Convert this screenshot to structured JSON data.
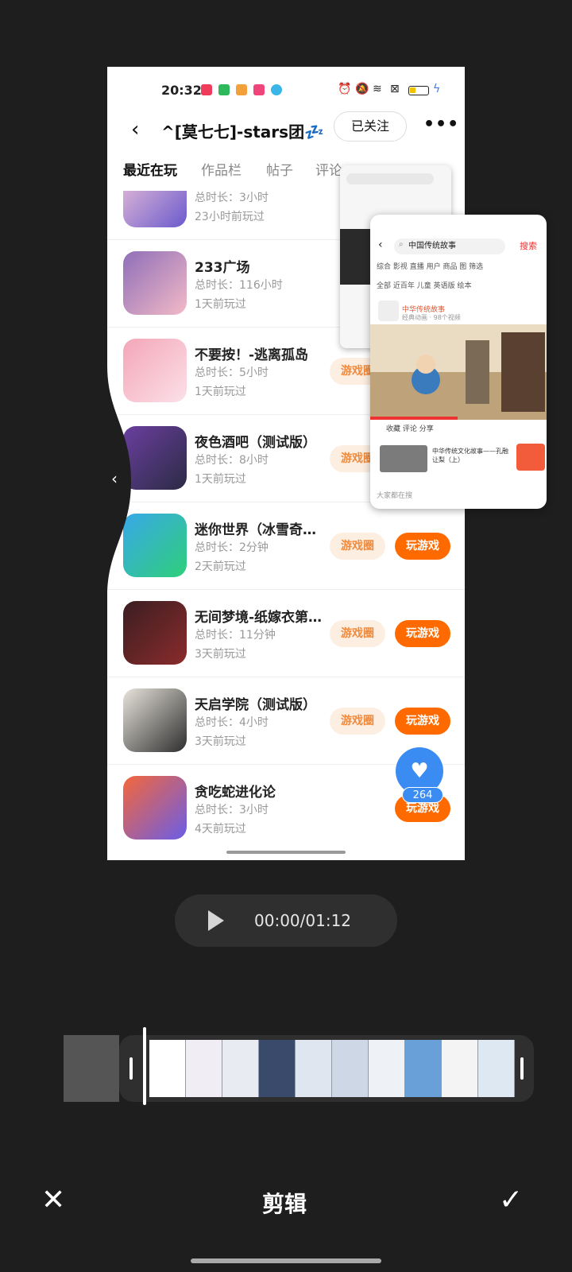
{
  "preview": {
    "status_time": "20:32",
    "title": "^[莫七七]-stars团💤",
    "follow_label": "已关注",
    "more_label": "•••",
    "tabs": [
      "最近在玩",
      "作品栏",
      "帖子",
      "评论"
    ],
    "games": [
      {
        "name": "",
        "duration": "总时长：3小时",
        "last": "23小时前玩过",
        "colors": [
          "#f2c6d8",
          "#6a5acd"
        ]
      },
      {
        "name": "233广场",
        "duration": "总时长：116小时",
        "last": "1天前玩过",
        "colors": [
          "#8e6fb8",
          "#f3b9c7"
        ]
      },
      {
        "name": "不要按！-逃离孤岛",
        "duration": "总时长：5小时",
        "last": "1天前玩过",
        "colors": [
          "#f3a6b8",
          "#fce0e8"
        ]
      },
      {
        "name": "夜色酒吧（测试版）",
        "duration": "总时长：8小时",
        "last": "1天前玩过",
        "colors": [
          "#6b3fa0",
          "#2b2b44"
        ]
      },
      {
        "name": "迷你世界（冰雪奇…",
        "duration": "总时长：2分钟",
        "last": "2天前玩过",
        "colors": [
          "#38a8e8",
          "#2fcf7a"
        ]
      },
      {
        "name": "无间梦境-纸嫁衣第…",
        "duration": "总时长：11分钟",
        "last": "3天前玩过",
        "colors": [
          "#3a1e22",
          "#8b2b2b"
        ]
      },
      {
        "name": "天启学院（测试版）",
        "duration": "总时长：4小时",
        "last": "3天前玩过",
        "colors": [
          "#e8e4dc",
          "#2e2e2e"
        ]
      },
      {
        "name": "贪吃蛇进化论",
        "duration": "总时长：3小时",
        "last": "4天前玩过",
        "colors": [
          "#f5673a",
          "#6a5de8"
        ]
      }
    ],
    "circle_label": "游戏圈",
    "play_label": "玩游戏",
    "like_count": "264"
  },
  "mini_window": {
    "search_text": "中国传统故事",
    "search_btn": "搜索",
    "tabs": "综合  影视  直播  用户  商品  图  筛选",
    "subtabs": "全部   近百年   儿童   英语版   绘本",
    "channel": "中华传统故事",
    "channel_sub": "经典动画 · 98个视频",
    "actions": "收藏      评论      分享",
    "card_text": "中华传统文化故事——孔融让梨（上）",
    "footer": "大家都在搜"
  },
  "player": {
    "time": "00:00/01:12"
  },
  "bottom": {
    "close_icon": "✕",
    "title": "剪辑",
    "confirm_icon": "✓"
  },
  "timeline_colors": [
    "#ffffff",
    "#f0eef4",
    "#e8ecf2",
    "#3a4a6a",
    "#dfe6ef",
    "#cdd7e6",
    "#eef1f5",
    "#6aa0d8",
    "#f4f4f4",
    "#dde8f2"
  ]
}
